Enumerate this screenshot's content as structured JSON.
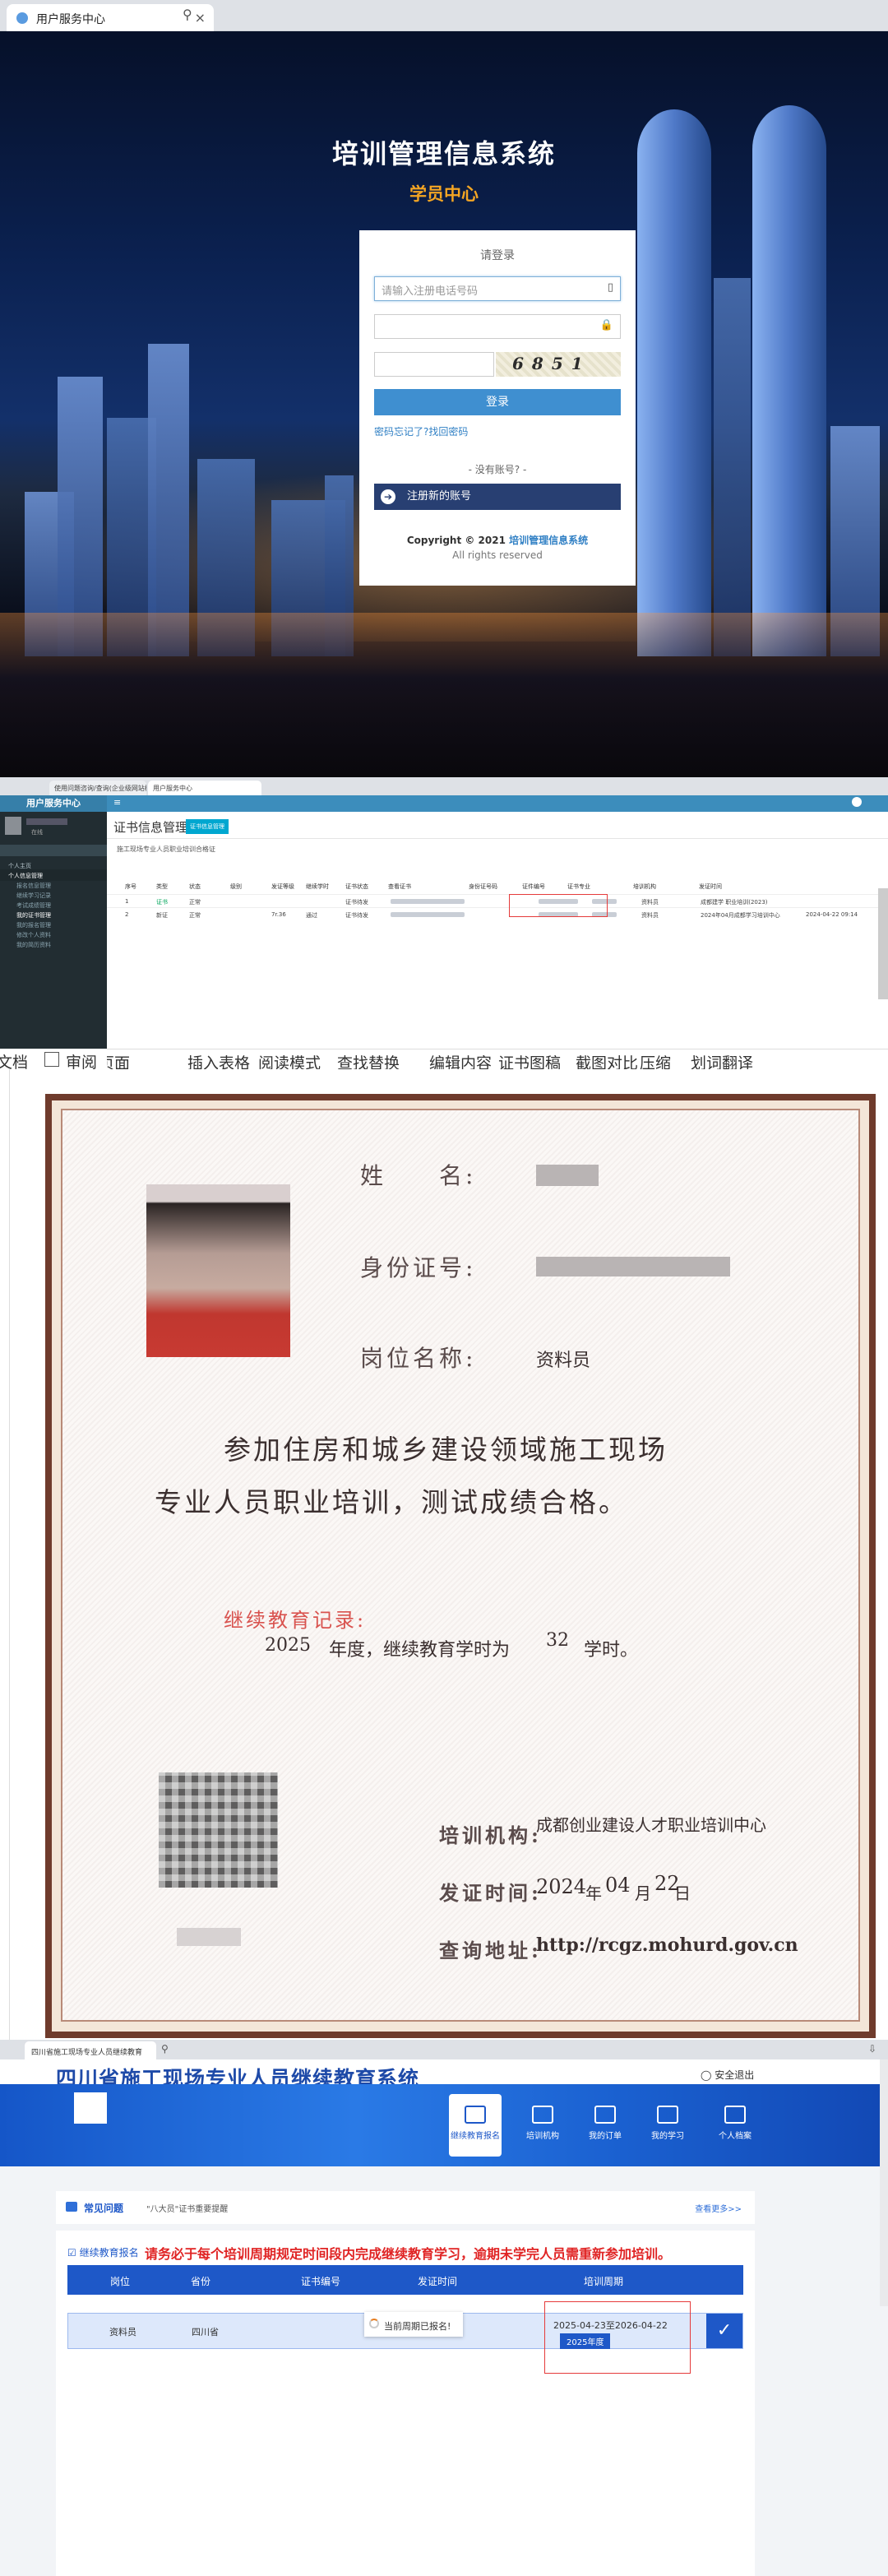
{
  "login": {
    "tab_title": "用户服务中心",
    "system_title": "培训管理信息系统",
    "subtitle": "学员中心",
    "card_heading": "请登录",
    "phone_placeholder": "请输入注册电话号码",
    "captcha_text": "6851",
    "login_button": "登录",
    "forgot_text": "密码忘记了?找回密码",
    "no_account": "- 没有账号? -",
    "register_button": "注册新的账号",
    "copyright_prefix": "Copyright © 2021",
    "copyright_org": "培训管理信息系统",
    "rights": "All rights reserved"
  },
  "cert_mgmt": {
    "tab_a": "使用问题咨询/查询(企业级网站模型)",
    "tab_b": "用户服务中心",
    "brand": "用户服务中心",
    "user_status": "在线",
    "sidebar": [
      {
        "label": "个人主页",
        "type": "item"
      },
      {
        "label": "个人信息管理",
        "type": "head"
      },
      {
        "label": "报名信息管理",
        "type": "sub"
      },
      {
        "label": "继续学习记录",
        "type": "sub"
      },
      {
        "label": "考试成绩管理",
        "type": "sub"
      },
      {
        "label": "我的证书管理",
        "type": "sub-active"
      },
      {
        "label": "我的报名管理",
        "type": "sub"
      },
      {
        "label": "修改个人资料",
        "type": "sub"
      },
      {
        "label": "我的简历资料",
        "type": "sub"
      }
    ],
    "page_title": "证书信息管理",
    "page_badge": "证书信息管理",
    "page_desc": "施工现场专业人员职业培训合格证",
    "columns": [
      "序号",
      "类型",
      "状态",
      "级别",
      "发证等级",
      "继续学时",
      "证书状态",
      "查看证书",
      "身份证号码",
      "证件编号",
      "证书专业",
      "培训机构",
      "发证时间"
    ],
    "rows": [
      {
        "no": "1",
        "type": "证书",
        "status": "正常",
        "level": "",
        "grade": "",
        "hours": "",
        "cstatus": "证书待发",
        "major": "资料员",
        "org": "成都建学 职业培训(2023)",
        "date": ""
      },
      {
        "no": "2",
        "type": "新证",
        "status": "正常",
        "level": "",
        "grade": "7r.36",
        "hours": "通过",
        "cstatus": "证书待发",
        "major": "资料员",
        "org": "2024年04月成都学习培训中心",
        "date": "2024-04-22 09:14"
      }
    ],
    "bottom_toolbar": [
      "文档",
      "审阅",
      "页面",
      "插入表格",
      "阅读模式",
      "查找替换",
      "编辑内容",
      "证书图稿",
      "截图对比",
      "压缩",
      "划词翻译"
    ]
  },
  "certificate": {
    "name_label": "姓　　名:",
    "id_label": "身份证号:",
    "position_label": "岗位名称:",
    "position_value": "资料员",
    "main_line1": "参加住房和城乡建设领域施工现场",
    "main_line2": "专业人员职业培训，测试成绩合格。",
    "ce_title": "继续教育记录:",
    "ce_year": "2025",
    "ce_mid": "年度，继续教育学时为",
    "ce_hours": "32",
    "ce_end": "学时。",
    "org_label": "培训机构:",
    "org_value": "成都创业建设人才职业培训中心",
    "issue_label": "发证时间:",
    "issue_y": "2024",
    "issue_m": "04",
    "issue_d": "22",
    "year_char": "年",
    "month_char": "月",
    "day_char": "日",
    "query_label": "查询地址:",
    "query_value": "http://rcgz.mohurd.gov.cn"
  },
  "sichuan": {
    "tab_title": "四川省施工现场专业人员继续教育",
    "title": "四川省施工现场专业人员继续教育系统",
    "safe_exit": "安全退出",
    "nav": [
      {
        "label": "继续教育报名",
        "active": true
      },
      {
        "label": "培训机构",
        "active": false
      },
      {
        "label": "我的订单",
        "active": false
      },
      {
        "label": "我的学习",
        "active": false
      },
      {
        "label": "个人档案",
        "active": false
      }
    ],
    "faq_title": "常见问题",
    "faq_desc": "\"八大员\"证书重要提醒",
    "faq_more": "查看更多>>",
    "ce_tag": "继续教育报名",
    "warning": "请务必于每个培训周期规定时间段内完成继续教育学习，逾期未学完人员需重新参加培训。",
    "columns": [
      "岗位",
      "省份",
      "证书编号",
      "发证时间",
      "培训周期"
    ],
    "row": {
      "position": "资料员",
      "province": "四川省",
      "tip": "当前周期已报名!",
      "period": "2025-04-23至2026-04-22",
      "year_badge": "2025年度"
    }
  }
}
